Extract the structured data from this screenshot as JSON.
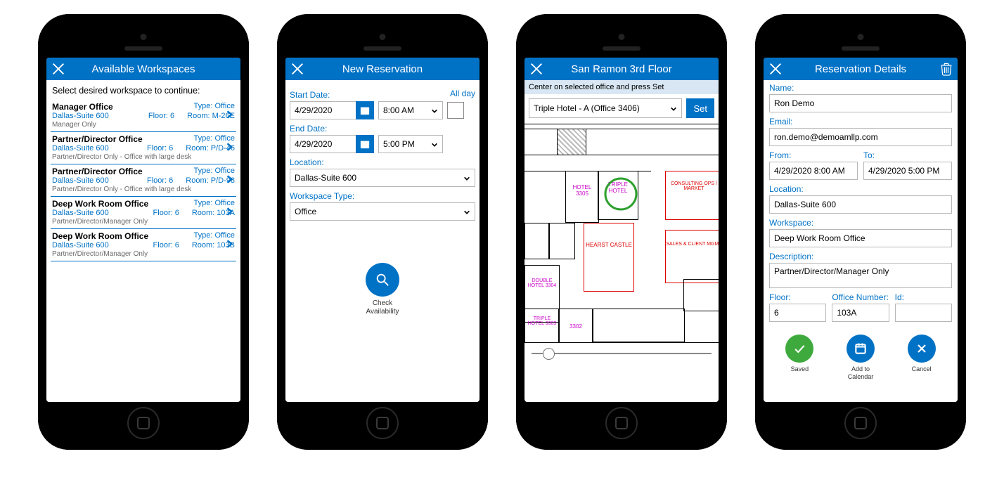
{
  "screens": {
    "available": {
      "title": "Available Workspaces",
      "instruction": "Select desired workspace to continue:",
      "items": [
        {
          "name": "Manager Office",
          "type": "Type: Office",
          "loc": "Dallas-Suite 600",
          "floor": "Floor: 6",
          "room": "Room: M-26E",
          "desc": "Manager Only"
        },
        {
          "name": "Partner/Director Office",
          "type": "Type: Office",
          "loc": "Dallas-Suite 600",
          "floor": "Floor: 6",
          "room": "Room: P/D-46",
          "desc": "Partner/Director Only - Office with large desk"
        },
        {
          "name": "Partner/Director Office",
          "type": "Type: Office",
          "loc": "Dallas-Suite 600",
          "floor": "Floor: 6",
          "room": "Room: P/D-98",
          "desc": "Partner/Director Only - Office with large desk"
        },
        {
          "name": "Deep Work Room Office",
          "type": "Type: Office",
          "loc": "Dallas-Suite 600",
          "floor": "Floor: 6",
          "room": "Room: 103A",
          "desc": "Partner/Director/Manager Only"
        },
        {
          "name": "Deep Work Room Office",
          "type": "Type: Office",
          "loc": "Dallas-Suite 600",
          "floor": "Floor: 6",
          "room": "Room: 103B",
          "desc": "Partner/Director/Manager Only"
        }
      ]
    },
    "newres": {
      "title": "New Reservation",
      "start_label": "Start Date:",
      "end_label": "End Date:",
      "allday_label": "All day",
      "start_date": "4/29/2020",
      "start_time": "8:00 AM",
      "end_date": "4/29/2020",
      "end_time": "5:00 PM",
      "location_label": "Location:",
      "location": "Dallas-Suite 600",
      "wstype_label": "Workspace Type:",
      "wstype": "Office",
      "check_label": "Check\nAvailability"
    },
    "floor": {
      "title": "San Ramon 3rd Floor",
      "tip": "Center on selected office and press Set",
      "office": "Triple Hotel - A (Office 3406)",
      "set": "Set",
      "labels": {
        "hotel": "HOTEL 3305",
        "triple": "TRIPLE HOTEL",
        "consult": "CONSULTING OPS / MARKET",
        "double": "DOUBLE HOTEL 3304",
        "hearst": "HEARST CASTLE",
        "sales": "SALES & CLIENT MGMT",
        "triple2": "TRIPLE HOTEL 3303",
        "r3302": "3302"
      }
    },
    "details": {
      "title": "Reservation Details",
      "name_label": "Name:",
      "name": "Ron Demo",
      "email_label": "Email:",
      "email": "ron.demo@demoamllp.com",
      "from_label": "From:",
      "from": "4/29/2020 8:00 AM",
      "to_label": "To:",
      "to": "4/29/2020 5:00 PM",
      "location_label": "Location:",
      "location": "Dallas-Suite 600",
      "workspace_label": "Workspace:",
      "workspace": "Deep Work Room Office",
      "desc_label": "Description:",
      "desc": "Partner/Director/Manager Only",
      "floor_label": "Floor:",
      "floor": "6",
      "office_label": "Office Number:",
      "office": "103A",
      "id_label": "Id:",
      "id": "",
      "saved": "Saved",
      "addcal": "Add to\nCalendar",
      "cancel": "Cancel"
    }
  }
}
